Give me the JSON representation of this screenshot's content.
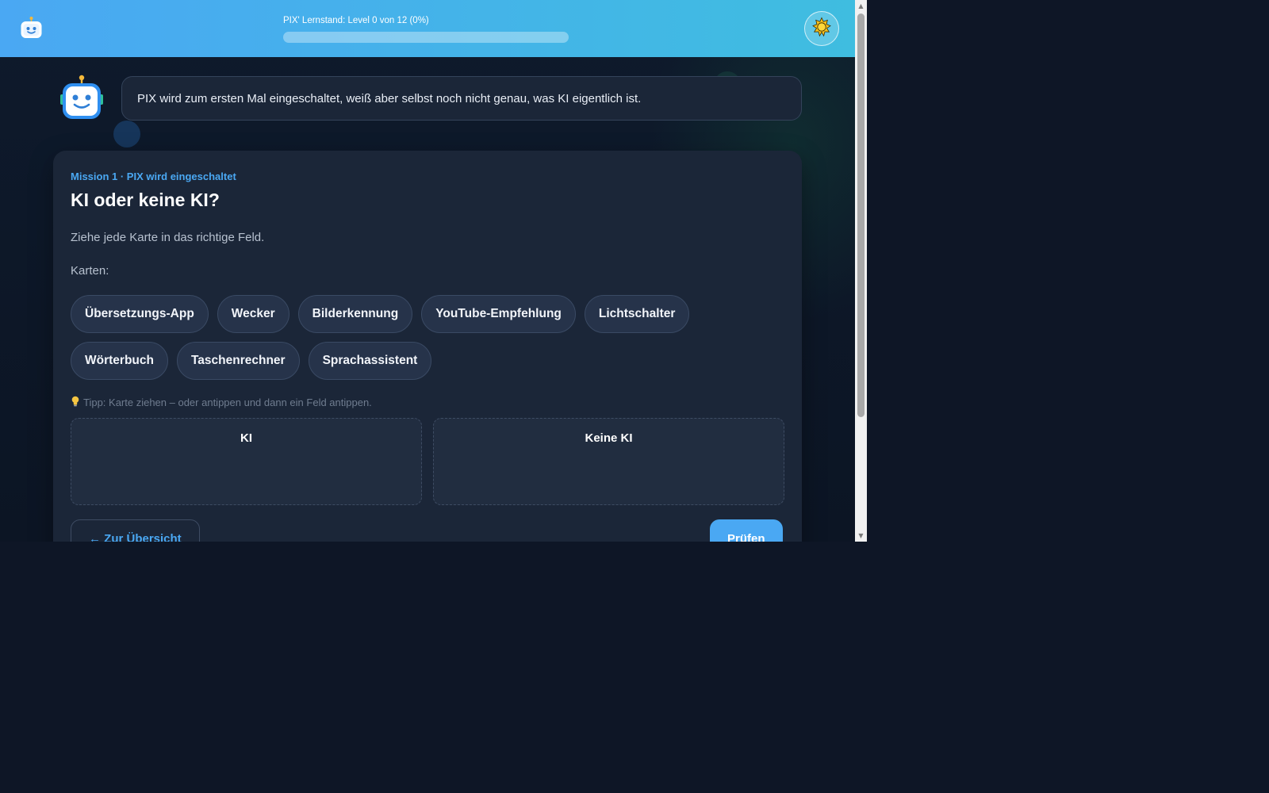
{
  "header": {
    "progress_label": "PIX' Lernstand: Level 0 von 12 (0%)",
    "progress_fraction": 0,
    "logo_icon": "robot-icon",
    "theme_icon": "sun-icon"
  },
  "pix": {
    "avatar_icon": "robot-icon",
    "speech": "PIX wird zum ersten Mal eingeschaltet, weiß aber selbst noch nicht genau, was KI eigentlich ist."
  },
  "mission": {
    "subtitle": "Mission 1 · PIX wird eingeschaltet",
    "title": "KI oder keine KI?",
    "instruction": "Ziehe jede Karte in das richtige Feld.",
    "cards_label": "Karten:",
    "cards": [
      "Übersetzungs-App",
      "Wecker",
      "Bilderkennung",
      "YouTube-Empfehlung",
      "Lichtschalter",
      "Wörterbuch",
      "Taschenrechner",
      "Sprachassistent"
    ],
    "tip_icon": "lightbulb-icon",
    "tip": "Tipp: Karte ziehen – oder antippen und dann ein Feld antippen.",
    "zones": [
      "KI",
      "Keine KI"
    ],
    "back_label": "← Zur Übersicht",
    "check_label": "Prüfen"
  },
  "colors": {
    "accent": "#4aa8f3",
    "header_gradient_start": "#4aa8f3",
    "header_gradient_end": "#3fbde0",
    "card_bg": "#1b2638",
    "page_bg": "#0e1626"
  }
}
